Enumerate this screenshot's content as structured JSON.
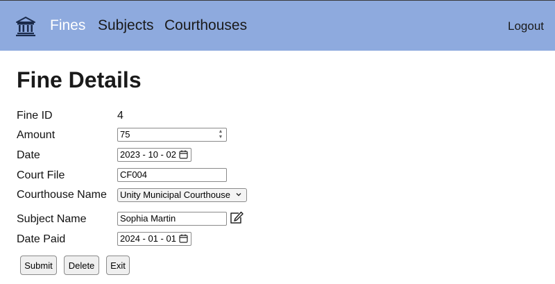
{
  "nav": {
    "logo_icon": "courthouse-icon",
    "links": [
      "Fines",
      "Subjects",
      "Courthouses"
    ],
    "active": "Fines",
    "logout_label": "Logout",
    "background": "#8eaade"
  },
  "page": {
    "title": "Fine Details"
  },
  "form": {
    "fine_id": {
      "label": "Fine ID",
      "value": "4"
    },
    "amount": {
      "label": "Amount",
      "value": "75"
    },
    "date": {
      "label": "Date",
      "value": "2023 - 10 - 02"
    },
    "court_file": {
      "label": "Court File",
      "value": "CF004"
    },
    "courthouse_name": {
      "label": "Courthouse Name",
      "value": "Unity Municipal Courthouse"
    },
    "subject_name": {
      "label": "Subject Name",
      "value": "Sophia Martin",
      "edit_icon": "edit-icon"
    },
    "date_paid": {
      "label": "Date Paid",
      "value": "2024 - 01 - 01"
    }
  },
  "buttons": {
    "submit": "Submit",
    "delete": "Delete",
    "exit": "Exit"
  }
}
